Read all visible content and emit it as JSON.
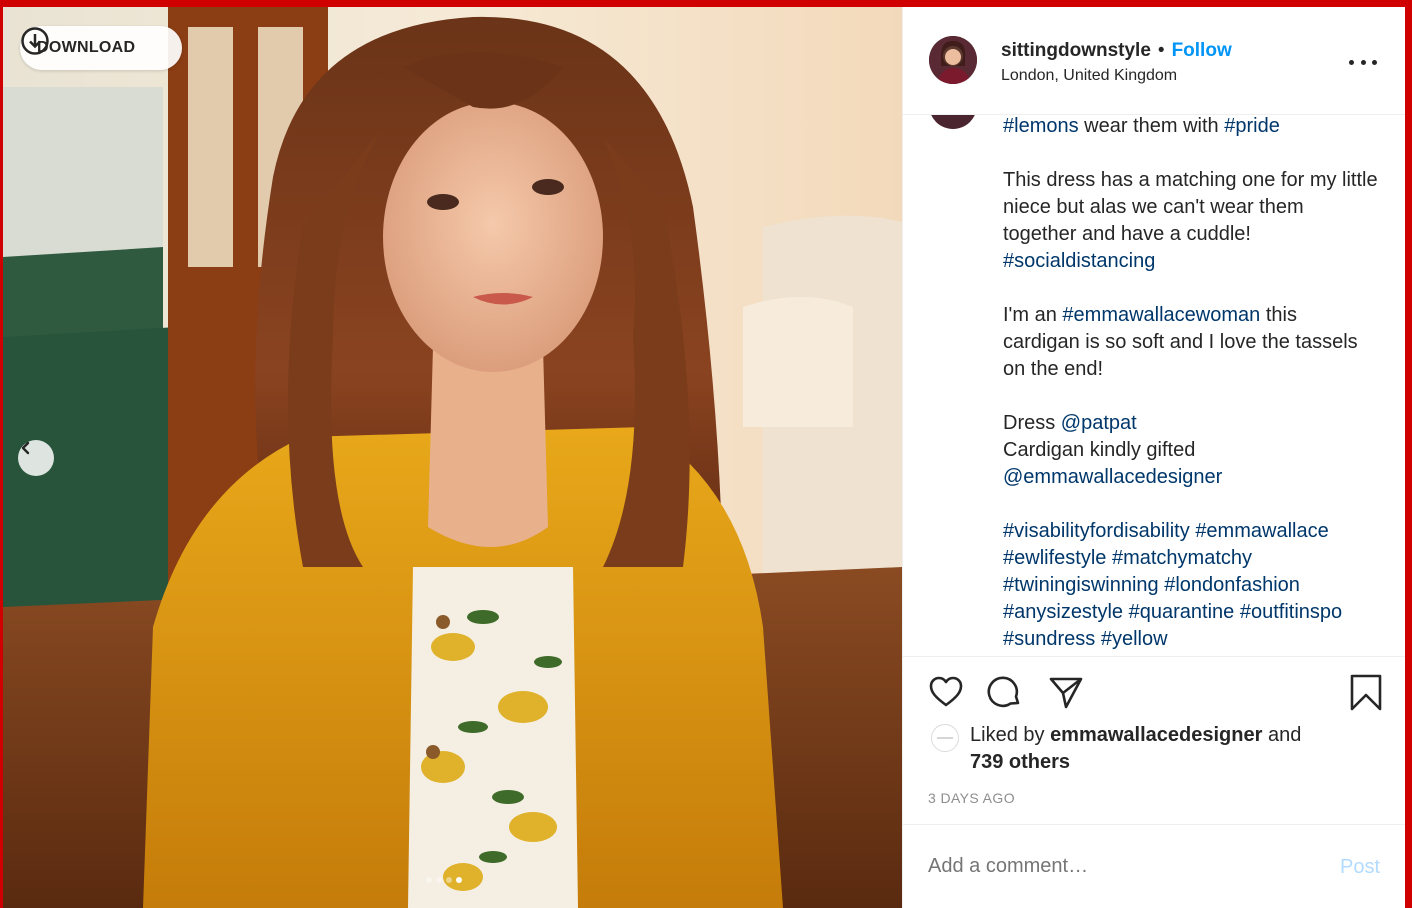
{
  "download": {
    "label": "DOWNLOAD"
  },
  "carousel": {
    "slide_count": 4,
    "active_index": 3
  },
  "post": {
    "username": "sittingdownstyle",
    "separator": "•",
    "follow_label": "Follow",
    "location": "London, United Kingdom",
    "caption": {
      "line0": [
        {
          "t": "#lemons",
          "tag": true
        },
        {
          "t": " wear them with ",
          "tag": false
        },
        {
          "t": "#pride",
          "tag": true
        }
      ],
      "para1": [
        {
          "t": "This dress has a matching one for my little niece but alas we can't wear them together and have a cuddle! ",
          "tag": false
        },
        {
          "t": "#socialdistancing",
          "tag": true
        }
      ],
      "para2": [
        {
          "t": "I'm an ",
          "tag": false
        },
        {
          "t": "#emmawallacewoman",
          "tag": true
        },
        {
          "t": " this cardigan is so soft and I love the tassels on the end!",
          "tag": false
        }
      ],
      "para3a": [
        {
          "t": "Dress ",
          "tag": false
        },
        {
          "t": "@patpat",
          "tag": true
        }
      ],
      "para3b": [
        {
          "t": "Cardigan kindly gifted ",
          "tag": false
        },
        {
          "t": "@emmawallacedesigner",
          "tag": true
        }
      ],
      "para4": [
        {
          "t": "#visabilityfordisability",
          "tag": true
        },
        {
          "t": " ",
          "tag": false
        },
        {
          "t": "#emmawallace",
          "tag": true
        },
        {
          "t": " ",
          "tag": false
        },
        {
          "t": "#ewlifestyle",
          "tag": true
        },
        {
          "t": " ",
          "tag": false
        },
        {
          "t": "#matchymatchy",
          "tag": true
        },
        {
          "t": " ",
          "tag": false
        },
        {
          "t": "#twiningiswinning",
          "tag": true
        },
        {
          "t": " ",
          "tag": false
        },
        {
          "t": "#londonfashion",
          "tag": true
        },
        {
          "t": " ",
          "tag": false
        },
        {
          "t": "#anysizestyle",
          "tag": true
        },
        {
          "t": " ",
          "tag": false
        },
        {
          "t": "#quarantine",
          "tag": true
        },
        {
          "t": " ",
          "tag": false
        },
        {
          "t": "#outfitinspo",
          "tag": true
        },
        {
          "t": " ",
          "tag": false
        },
        {
          "t": "#sundress",
          "tag": true
        },
        {
          "t": " ",
          "tag": false
        },
        {
          "t": "#yellow",
          "tag": true
        }
      ]
    },
    "likes": {
      "prefix": "Liked by ",
      "user": "emmawallacedesigner",
      "and": " and ",
      "others": "739 others"
    },
    "timestamp": "3 DAYS AGO",
    "comment_placeholder": "Add a comment…",
    "post_label": "Post"
  },
  "icons": {
    "download": "download-circle-icon",
    "prev": "chevron-left-icon",
    "like": "heart-icon",
    "comment": "comment-bubble-icon",
    "share": "paper-plane-icon",
    "save": "bookmark-icon",
    "more": "more-options-icon"
  },
  "colors": {
    "frame": "#d00000",
    "link": "#00376b",
    "follow": "#0095f6",
    "post_disabled": "#b3dbff",
    "muted": "#8e8e8e"
  }
}
